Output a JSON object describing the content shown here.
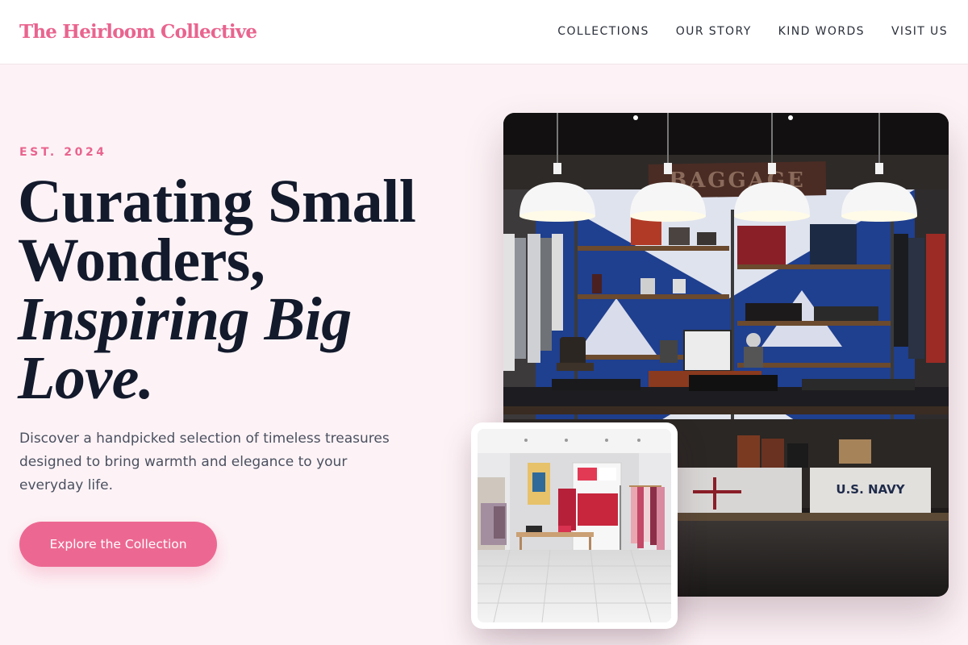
{
  "brand": {
    "name": "The Heirloom Collective"
  },
  "nav": {
    "items": [
      {
        "label": "COLLECTIONS"
      },
      {
        "label": "OUR STORY"
      },
      {
        "label": "KIND WORDS"
      },
      {
        "label": "VISIT US"
      }
    ]
  },
  "hero": {
    "eyebrow": "EST. 2024",
    "headline_line1": "Curating Small",
    "headline_line2": "Wonders,",
    "headline_line3": "Inspiring Big",
    "headline_line4": "Love.",
    "description": "Discover a handpicked selection of timeless treasures designed to bring warmth and elegance to your everyday life.",
    "cta_label": "Explore the Collection"
  },
  "photos": {
    "main_sign_text": "BAGGAGE",
    "main_crate_text": "U.S. NAVY"
  },
  "colors": {
    "accent": "#e9648f",
    "button": "#ec6892",
    "background": "#fdf3f6",
    "heading": "#131a2c"
  }
}
